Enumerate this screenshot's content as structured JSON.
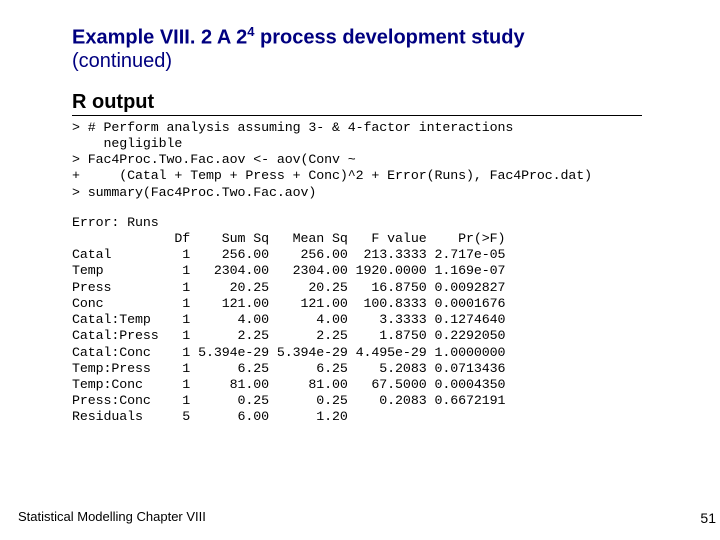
{
  "header": {
    "title_prefix": "Example VIII. 2 A 2",
    "title_sup": "4",
    "title_suffix": " process development study",
    "continued": "(continued)"
  },
  "section": {
    "heading": "R output"
  },
  "code": {
    "input": "> # Perform analysis assuming 3- & 4-factor interactions \n    negligible\n> Fac4Proc.Two.Fac.aov <- aov(Conv ~\n+     (Catal + Temp + Press + Conc)^2 + Error(Runs), Fac4Proc.dat)\n> summary(Fac4Proc.Two.Fac.aov)",
    "output": "Error: Runs\n             Df    Sum Sq   Mean Sq   F value    Pr(>F)\nCatal         1    256.00    256.00  213.3333 2.717e-05\nTemp          1   2304.00   2304.00 1920.0000 1.169e-07\nPress         1     20.25     20.25   16.8750 0.0092827\nConc          1    121.00    121.00  100.8333 0.0001676\nCatal:Temp    1      4.00      4.00    3.3333 0.1274640\nCatal:Press   1      2.25      2.25    1.8750 0.2292050\nCatal:Conc    1 5.394e-29 5.394e-29 4.495e-29 1.0000000\nTemp:Press    1      6.25      6.25    5.2083 0.0713436\nTemp:Conc     1     81.00     81.00   67.5000 0.0004350\nPress:Conc    1      0.25      0.25    0.2083 0.6672191\nResiduals     5      6.00      1.20"
  },
  "footer": {
    "text": "Statistical Modelling   Chapter VIII",
    "page": "51"
  }
}
